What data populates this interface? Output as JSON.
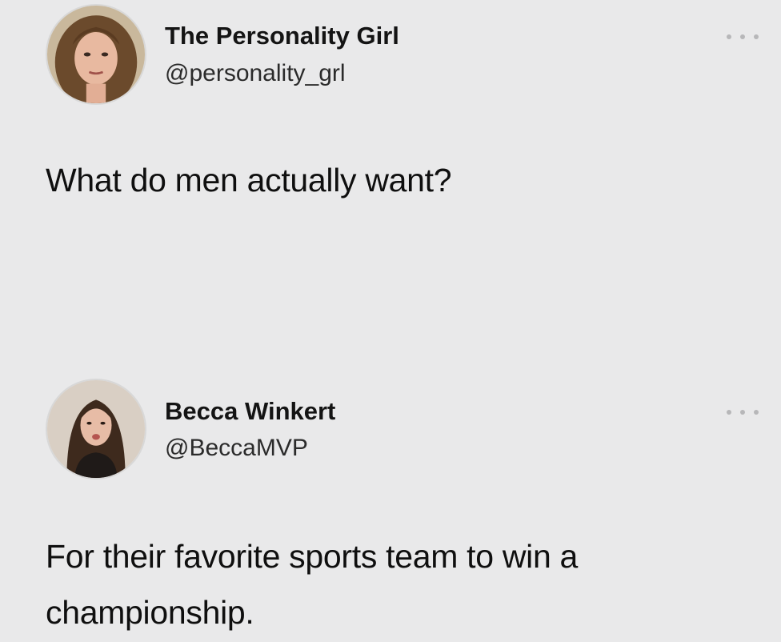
{
  "tweets": [
    {
      "author_name": "The Personality Girl",
      "author_handle": "@personality_grl",
      "text": "What do men actually want?",
      "avatar_icon": "profile-photo-woman-curly-hair",
      "more_icon": "ellipsis-icon"
    },
    {
      "author_name": "Becca Winkert",
      "author_handle": "@BeccaMVP",
      "text": "For their favorite sports team to win a championship.",
      "avatar_icon": "profile-photo-woman-long-hair",
      "more_icon": "ellipsis-icon"
    }
  ],
  "colors": {
    "background": "#e9e9ea",
    "text": "#0f0f0f",
    "handle": "#2b2b2b",
    "dots": "#b7b7b9"
  }
}
